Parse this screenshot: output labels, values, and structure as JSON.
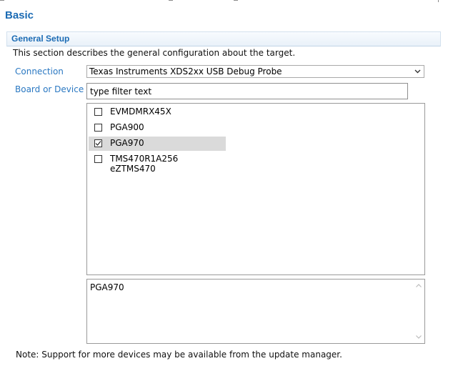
{
  "page": {
    "title": "Basic"
  },
  "section": {
    "title": "General Setup",
    "description": "This section describes the general configuration about the target."
  },
  "connection": {
    "label": "Connection",
    "selected": "Texas Instruments XDS2xx USB Debug Probe",
    "icon": "chevron-down-icon"
  },
  "board_device": {
    "label": "Board or Device",
    "filter_value": "type filter text"
  },
  "device_list": {
    "items": [
      {
        "label": "EVMDMRX45X",
        "checked": false
      },
      {
        "label": "PGA900",
        "checked": false
      },
      {
        "label": "PGA970",
        "checked": true,
        "selected": true
      },
      {
        "label": "TMS470R1A256 eZTMS470",
        "checked": false
      }
    ]
  },
  "details": {
    "text": "PGA970"
  },
  "note": {
    "text": "Note: Support for more devices may be available from the update manager."
  },
  "colors": {
    "accent": "#1b6bb4",
    "label": "#2a78c2",
    "selection": "#dadada"
  }
}
